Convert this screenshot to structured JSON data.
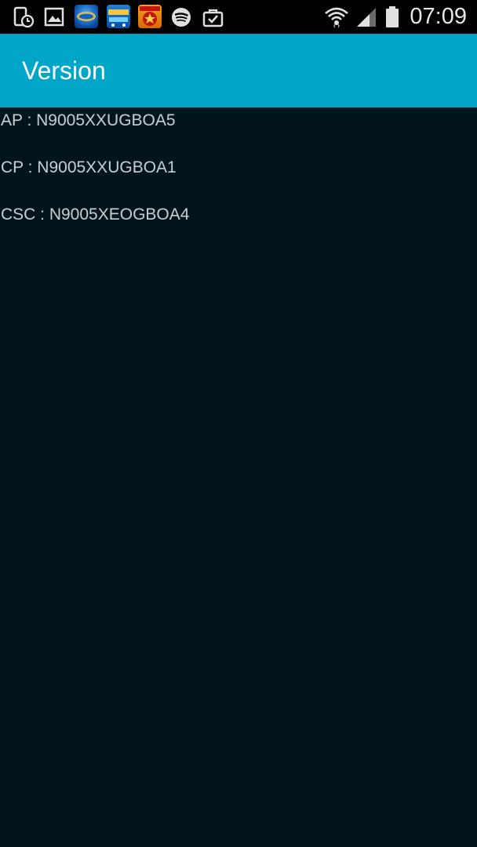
{
  "status_bar": {
    "time": "07:09",
    "notification_icons": [
      "screenshot-timer-icon",
      "gallery-icon",
      "bingo-game-icon",
      "bingo-game-2-icon",
      "casino-game-icon",
      "spotify-icon",
      "shopping-bag-icon"
    ],
    "system_icons": [
      "wifi-icon",
      "signal-icon",
      "battery-icon"
    ]
  },
  "app_bar": {
    "title": "Version",
    "color": "#00a6c8"
  },
  "content": {
    "background": "#02141c",
    "lines": [
      "AP : N9005XXUGBOA5",
      "CP : N9005XXUGBOA1",
      "CSC : N9005XEOGBOA4"
    ]
  }
}
